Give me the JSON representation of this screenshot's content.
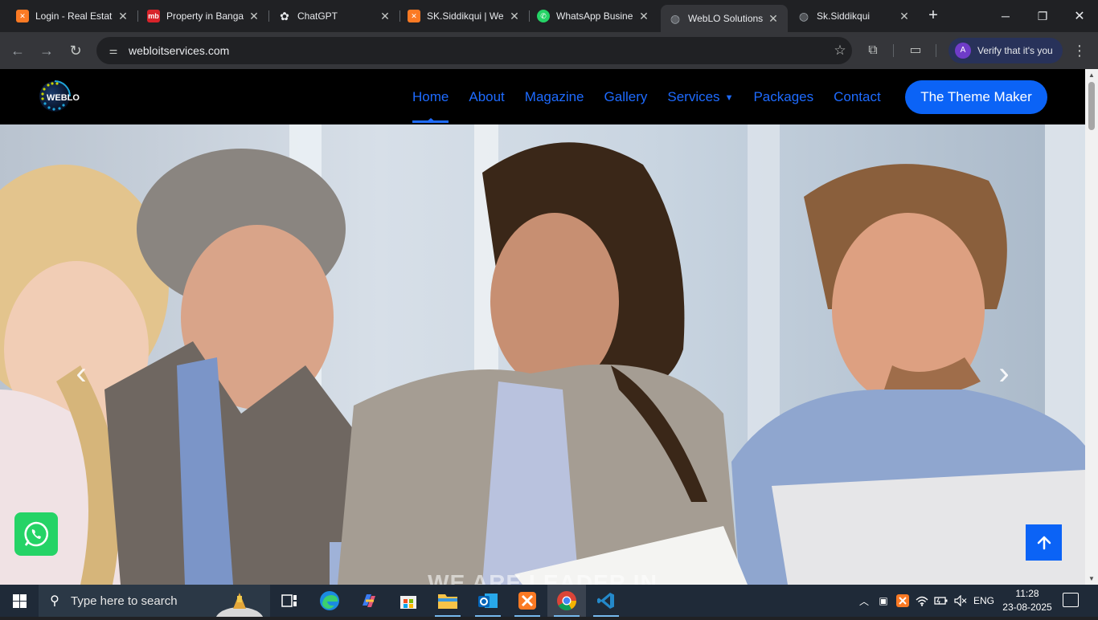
{
  "browser": {
    "tabs": [
      {
        "title": "Login - Real Estat",
        "icon": "xampp-icon",
        "color": "#fb7a24",
        "glyph": "✕"
      },
      {
        "title": "Property in Banga",
        "icon": "magicbricks-icon",
        "color": "#d8232a",
        "glyph": "mb"
      },
      {
        "title": "ChatGPT",
        "icon": "openai-icon",
        "color": "#202124",
        "glyph": "⚙"
      },
      {
        "title": "SK.Siddikqui | We",
        "icon": "xampp-icon",
        "color": "#fb7a24",
        "glyph": "✕"
      },
      {
        "title": "WhatsApp Busine",
        "icon": "whatsapp-icon",
        "color": "#25d366",
        "glyph": "✆"
      },
      {
        "title": "WebLO Solutions",
        "icon": "globe-icon",
        "color": "#9aa0a6",
        "glyph": "◍",
        "active": true
      },
      {
        "title": "Sk.Siddikqui",
        "icon": "globe-icon",
        "color": "#9aa0a6",
        "glyph": "◍"
      }
    ],
    "url": "webloitservices.com",
    "profile_initial": "A",
    "verify_text": "Verify that it's you"
  },
  "site": {
    "logo_text": "WEBLO",
    "nav": [
      {
        "label": "Home",
        "active": true
      },
      {
        "label": "About"
      },
      {
        "label": "Magazine"
      },
      {
        "label": "Gallery"
      },
      {
        "label": "Services",
        "dropdown": true
      },
      {
        "label": "Packages"
      },
      {
        "label": "Contact"
      }
    ],
    "cta_label": "The Theme Maker",
    "hero_caption": "WE ARE LEADER IN",
    "prev_label": "‹",
    "next_label": "›",
    "accent_color": "#0b63f6"
  },
  "taskbar": {
    "search_placeholder": "Type here to search",
    "apps": [
      "task-view-icon",
      "edge-icon",
      "copilot-icon",
      "store-icon",
      "file-explorer-icon",
      "outlook-icon",
      "xampp-icon",
      "chrome-icon",
      "vscode-icon"
    ],
    "language": "ENG",
    "time": "11:28",
    "date": "23-08-2025"
  }
}
